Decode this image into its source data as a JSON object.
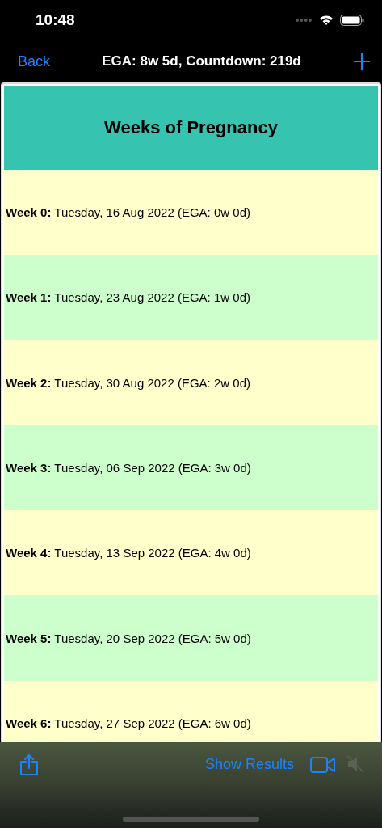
{
  "status_bar": {
    "time": "10:48"
  },
  "nav_bar": {
    "back": "Back",
    "title": "EGA: 8w 5d, Countdown: 219d"
  },
  "table": {
    "title": "Weeks of Pregnancy",
    "rows": [
      {
        "label": "Week 0:",
        "text": "Tuesday, 16 Aug 2022 (EGA: 0w 0d)",
        "color": "#ffffcc"
      },
      {
        "label": "Week 1:",
        "text": "Tuesday, 23 Aug 2022 (EGA: 1w 0d)",
        "color": "#ccffcc"
      },
      {
        "label": "Week 2:",
        "text": "Tuesday, 30 Aug 2022 (EGA: 2w 0d)",
        "color": "#ffffcc"
      },
      {
        "label": "Week 3:",
        "text": "Tuesday, 06 Sep 2022 (EGA: 3w 0d)",
        "color": "#ccffcc"
      },
      {
        "label": "Week 4:",
        "text": "Tuesday, 13 Sep 2022 (EGA: 4w 0d)",
        "color": "#ffffcc"
      },
      {
        "label": "Week 5:",
        "text": "Tuesday, 20 Sep 2022 (EGA: 5w 0d)",
        "color": "#ccffcc"
      },
      {
        "label": "Week 6:",
        "text": "Tuesday, 27 Sep 2022 (EGA: 6w 0d)",
        "color": "#ffffcc"
      }
    ]
  },
  "toolbar": {
    "show_results": "Show Results",
    "mute_disabled": true
  }
}
